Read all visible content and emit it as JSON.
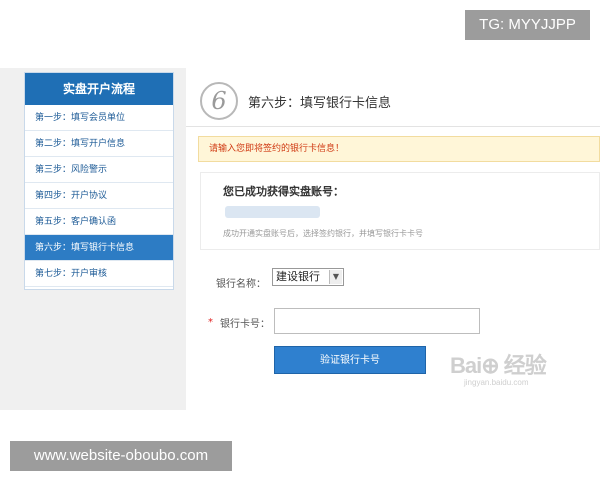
{
  "overlays": {
    "tg": "TG: MYYJJPP",
    "url": "www.website-oboubo.com"
  },
  "sidebar": {
    "title": "实盘开户流程",
    "items": [
      {
        "label": "第一步：填写会员单位"
      },
      {
        "label": "第二步：填写开户信息"
      },
      {
        "label": "第三步：风险警示"
      },
      {
        "label": "第四步：开户协议"
      },
      {
        "label": "第五步：客户确认函"
      },
      {
        "label": "第六步：填写银行卡信息"
      },
      {
        "label": "第七步：开户审核"
      }
    ],
    "active_index": 5
  },
  "main": {
    "step_number": "6",
    "step_title": "第六步：填写银行卡信息",
    "warning": "请输入您即将签约的银行卡信息！",
    "account_label": "您已成功获得实盘账号：",
    "account_note": "成功开通实盘账号后，选择签约银行，并填写银行卡卡号",
    "bank_label": "银行名称：",
    "bank_value": "建设银行",
    "card_required_mark": "*",
    "card_label": "银行卡号：",
    "card_value": "",
    "verify_button": "验证银行卡号"
  },
  "watermark": {
    "main": "Bai⊕ 经验",
    "sub": "jingyan.baidu.com"
  },
  "colors": {
    "accent": "#2d7cc4",
    "warning_text": "#d03b14",
    "warning_bg": "#fff6d8"
  }
}
